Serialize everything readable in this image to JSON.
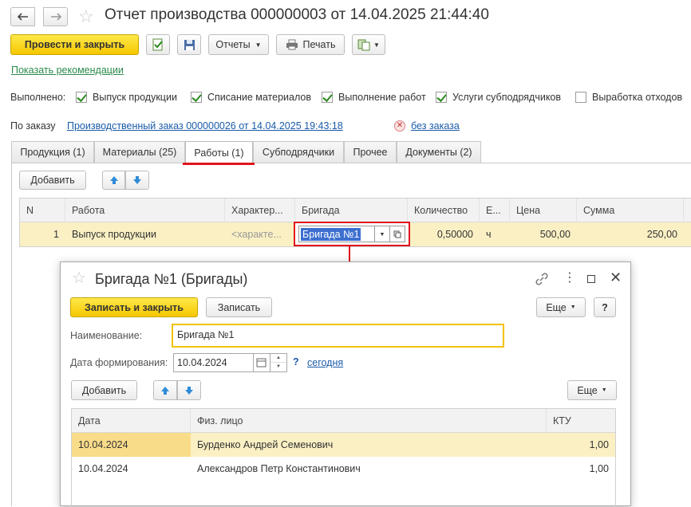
{
  "window": {
    "title": "Отчет производства 000000003 от 14.04.2025 21:44:40"
  },
  "toolbar": {
    "post_close": "Провести и закрыть",
    "reports": "Отчеты",
    "print": "Печать"
  },
  "recommendation_link": "Показать рекомендации",
  "done": {
    "label": "Выполнено:",
    "items": [
      {
        "label": "Выпуск продукции",
        "checked": true
      },
      {
        "label": "Списание материалов",
        "checked": true
      },
      {
        "label": "Выполнение работ",
        "checked": true
      },
      {
        "label": "Услуги субподрядчиков",
        "checked": true
      },
      {
        "label": "Выработка отходов",
        "checked": false
      }
    ]
  },
  "order": {
    "label": "По заказу",
    "link": "Производственный заказ 000000026 от 14.04.2025 19:43:18",
    "no_order": "без заказа"
  },
  "tabs": [
    {
      "label": "Продукция (1)"
    },
    {
      "label": "Материалы (25)"
    },
    {
      "label": "Работы (1)"
    },
    {
      "label": "Субподрядчики"
    },
    {
      "label": "Прочее"
    },
    {
      "label": "Документы (2)"
    }
  ],
  "works": {
    "add": "Добавить",
    "columns": [
      "N",
      "Работа",
      "Характер...",
      "Бригада",
      "Количество",
      "Е...",
      "Цена",
      "Сумма"
    ],
    "row": {
      "n": "1",
      "work": "Выпуск продукции",
      "char_placeholder": "<характе...",
      "brigade": "Бригада №1",
      "qty": "0,50000",
      "unit": "ч",
      "price": "500,00",
      "sum": "250,00"
    }
  },
  "dialog": {
    "title": "Бригада №1 (Бригады)",
    "save_close": "Записать и закрыть",
    "save": "Записать",
    "more": "Еще",
    "help": "?",
    "name_label": "Наименование:",
    "name_value": "Бригада №1",
    "date_label": "Дата формирования:",
    "date_value": "10.04.2024",
    "today": "сегодня",
    "question": "?",
    "add": "Добавить",
    "more2": "Еще",
    "columns": [
      "Дата",
      "Физ. лицо",
      "КТУ"
    ],
    "rows": [
      {
        "date": "10.04.2024",
        "person": "Бурденко Андрей Семенович",
        "ktu": "1,00"
      },
      {
        "date": "10.04.2024",
        "person": "Александров Петр Константинович",
        "ktu": "1,00"
      }
    ]
  },
  "colors": {
    "accent_yellow": "#f5c700",
    "highlight_red": "#e0141e",
    "link_blue": "#1a5ba8",
    "row_highlight": "#fbf0c4"
  }
}
